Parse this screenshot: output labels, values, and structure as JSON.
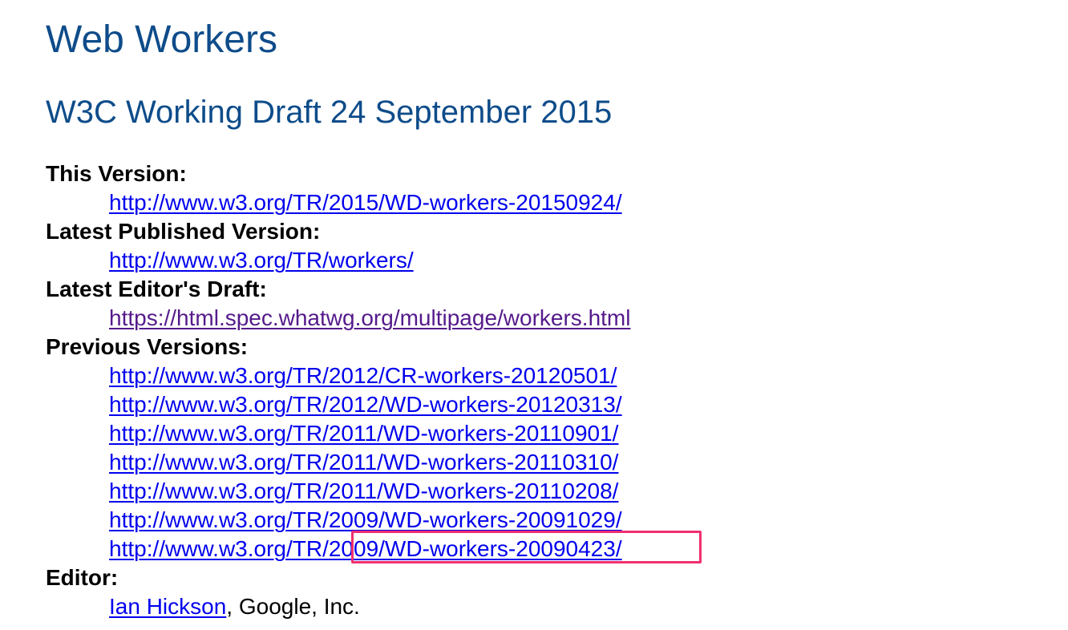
{
  "document": {
    "title": "Web Workers",
    "subtitle": "W3C Working Draft 24 September 2015"
  },
  "metadata": {
    "this_version": {
      "label": "This Version:",
      "url": "http://www.w3.org/TR/2015/WD-workers-20150924/"
    },
    "latest_published": {
      "label": "Latest Published Version:",
      "url": "http://www.w3.org/TR/workers/"
    },
    "latest_editors_draft": {
      "label": "Latest Editor's Draft:",
      "url": "https://html.spec.whatwg.org/multipage/workers.html"
    },
    "previous_versions": {
      "label": "Previous Versions:",
      "urls": [
        "http://www.w3.org/TR/2012/CR-workers-20120501/",
        "http://www.w3.org/TR/2012/WD-workers-20120313/",
        "http://www.w3.org/TR/2011/WD-workers-20110901/",
        "http://www.w3.org/TR/2011/WD-workers-20110310/",
        "http://www.w3.org/TR/2011/WD-workers-20110208/",
        "http://www.w3.org/TR/2009/WD-workers-20091029/",
        "http://www.w3.org/TR/2009/WD-workers-20090423/"
      ]
    },
    "editor": {
      "label": "Editor:",
      "name": "Ian Hickson",
      "affiliation": ", Google, Inc."
    }
  },
  "colors": {
    "heading": "#0e4c8a",
    "link": "#0000ee",
    "visited_link": "#551a8b",
    "highlight_border": "#f0306e"
  }
}
